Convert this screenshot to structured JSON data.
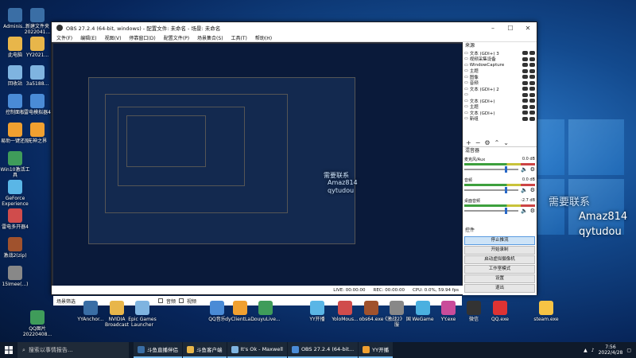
{
  "obs": {
    "title": "OBS 27.2.4 (64-bit, windows) - 配置文件: 未命名 - 场景: 未命名",
    "menu": [
      "文件(F)",
      "编辑(E)",
      "视图(V)",
      "停靠窗口(D)",
      "配置文件(P)",
      "场景集合(S)",
      "工具(T)",
      "帮助(H)"
    ],
    "sources_header": "来源",
    "sources": [
      "文本 (GDI+) 3",
      "视频采集设备",
      "WindowCapture",
      "主题",
      "图像",
      "音频",
      "文本 (GDI+) 2",
      "",
      "文本 (GDI+)",
      "主题",
      "文本 (GDI+)",
      "新组"
    ],
    "mixer_header": "混音器",
    "mixer": [
      {
        "name": "麦克风/Aux",
        "db": "0.0 dB"
      },
      {
        "name": "音频",
        "db": "0.0 dB"
      },
      {
        "name": "桌面音频",
        "db": "-2.7 dB"
      }
    ],
    "controls_header": "控件",
    "controls": [
      "停止推流",
      "开始录制",
      "启动虚拟摄像机",
      "工作室模式",
      "设置",
      "退出"
    ],
    "scene_bar": {
      "left": "场景筛选",
      "b1": "音频",
      "b2": "视频"
    },
    "status": {
      "live": "LIVE: 00:00:00",
      "rec": "REC: 00:00:00",
      "cpu": "CPU: 0.0%, 59.94 fps"
    },
    "preview_text": {
      "line1": "需要联系",
      "line2": "Amaz814",
      "line3": "qytudou"
    }
  },
  "wallpaper_text": {
    "line1": "需要联系",
    "line2": "Amaz814",
    "line3": "qytudou",
    "right1": "需要联系",
    "right2": "Amaz814",
    "right3": "qytudou"
  },
  "desktop_icons_left": [
    "Adminis...",
    "此电脑",
    "回收站",
    "控制面板",
    "易助一键还原",
    "Win10激活工具",
    "GeForce Experience",
    "雷电多开器4",
    "激战2(zip)",
    "15Imee(...)"
  ],
  "desktop_icons_col2": [
    "新建文件夹 2022041...",
    "YY2021...",
    "3a5188...",
    "雷电模拟器4",
    "无神之界",
    "QQ图片 20220408..."
  ],
  "desktop_icons_bottom": [
    "YYAnchor...",
    "NVIDIA Broadcast",
    "Epic Games Launcher",
    "QQ音乐",
    "dyClientLa...",
    "DouyuLive...",
    "YY开播",
    "YoloMous...",
    "obs64.exe",
    "《激战2》 国服",
    "WeGame",
    "YY.exe",
    "微信",
    "QQ.exe",
    "steam.exe"
  ],
  "taskbar": {
    "search": "搜索以事情报告...",
    "items": [
      "斗鱼直播伴侣",
      "斗鱼客户端",
      "It's Ok - Maxwell",
      "OBS 27.2.4 (64-bit...",
      "YY开播"
    ],
    "time": "7:56",
    "date": "2022/4/28"
  }
}
